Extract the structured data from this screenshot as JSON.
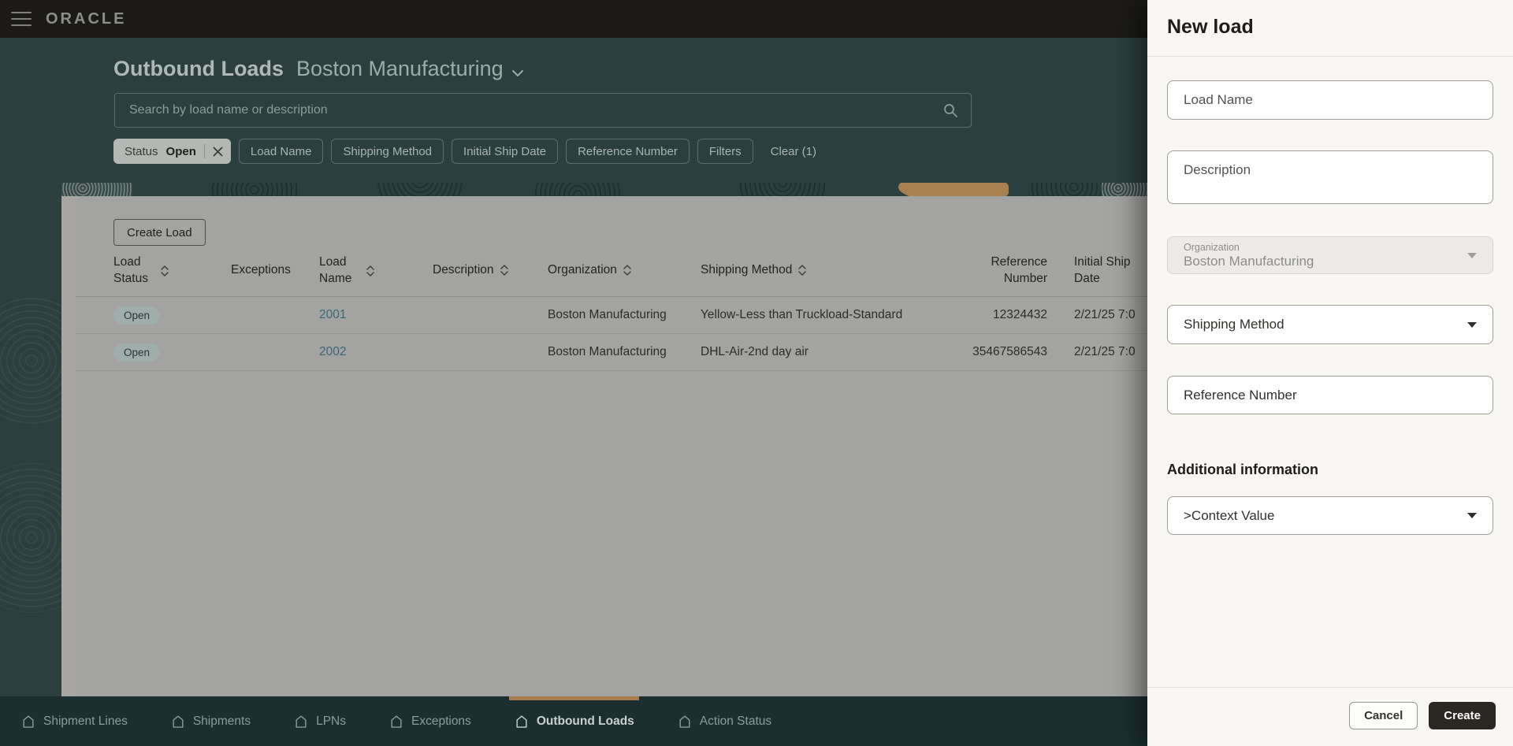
{
  "topbar": {
    "brand": "ORACLE"
  },
  "header": {
    "title": "Outbound Loads",
    "org_selector": "Boston Manufacturing"
  },
  "search": {
    "placeholder": "Search by load name or description"
  },
  "filters": {
    "status_chip": {
      "label": "Status",
      "value": "Open"
    },
    "chips": [
      "Load Name",
      "Shipping Method",
      "Initial Ship Date",
      "Reference Number",
      "Filters"
    ],
    "clear_label": "Clear (1)"
  },
  "toolbar": {
    "create_load_label": "Create Load"
  },
  "table": {
    "columns": [
      {
        "label": "Load Status",
        "sortable": true
      },
      {
        "label": "Exceptions",
        "sortable": false
      },
      {
        "label": "Load Name",
        "sortable": true
      },
      {
        "label": "Description",
        "sortable": true
      },
      {
        "label": "Organization",
        "sortable": true
      },
      {
        "label": "Shipping Method",
        "sortable": true
      },
      {
        "label": "Reference Number",
        "sortable": false
      },
      {
        "label": "Initial Ship Date",
        "sortable": false
      }
    ],
    "rows": [
      {
        "load_status": "Open",
        "exceptions": "",
        "load_name": "2001",
        "description": "",
        "organization": "Boston Manufacturing",
        "shipping_method": "Yellow-Less than Truckload-Standard",
        "reference_number": "12324432",
        "initial_ship_date": "2/21/25 7:0"
      },
      {
        "load_status": "Open",
        "exceptions": "",
        "load_name": "2002",
        "description": "",
        "organization": "Boston Manufacturing",
        "shipping_method": "DHL-Air-2nd day air",
        "reference_number": "35467586543",
        "initial_ship_date": "2/21/25 7:0"
      }
    ]
  },
  "bottom_nav": {
    "items": [
      {
        "label": "Shipment Lines",
        "active": false
      },
      {
        "label": "Shipments",
        "active": false
      },
      {
        "label": "LPNs",
        "active": false
      },
      {
        "label": "Exceptions",
        "active": false
      },
      {
        "label": "Outbound Loads",
        "active": true
      },
      {
        "label": "Action Status",
        "active": false
      }
    ]
  },
  "drawer": {
    "title": "New load",
    "fields": {
      "load_name": {
        "placeholder": "Load Name"
      },
      "description": {
        "placeholder": "Description"
      },
      "organization": {
        "label": "Organization",
        "value": "Boston Manufacturing",
        "disabled": true
      },
      "shipping_method": {
        "placeholder": "Shipping Method"
      },
      "reference_number": {
        "placeholder": "Reference Number"
      }
    },
    "additional_info": {
      "heading": "Additional information",
      "context_value": {
        "placeholder": ">Context Value"
      }
    },
    "actions": {
      "cancel": "Cancel",
      "create": "Create"
    }
  },
  "colors": {
    "accent_indicator": "#a87c4f",
    "teal_background": "#2b3f3e",
    "badge_background": "#9fadab",
    "link_text": "#3a6878",
    "create_button": "#2b2824"
  }
}
